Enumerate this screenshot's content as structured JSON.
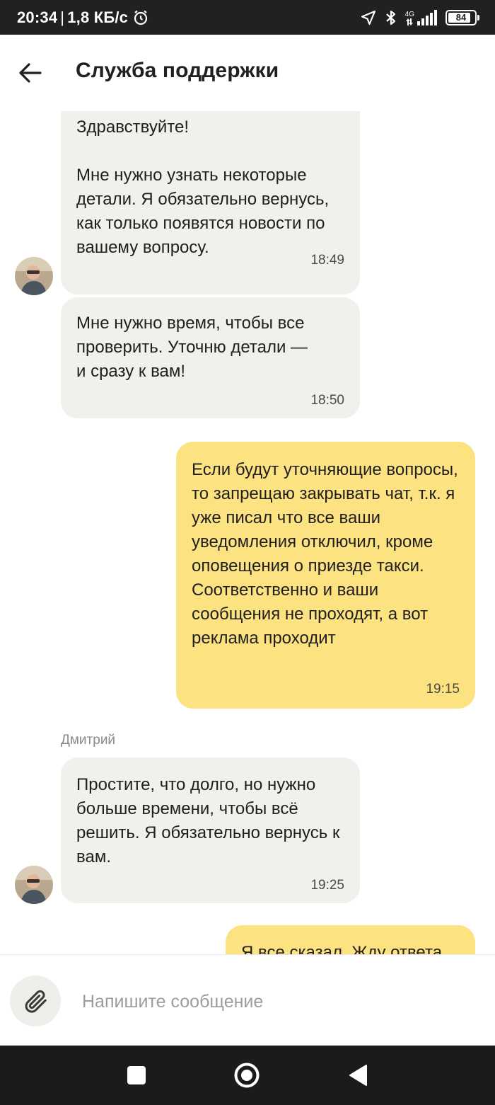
{
  "status_bar": {
    "time": "20:34",
    "separator": "|",
    "speed": "1,8 КБ/с",
    "network": "4G",
    "battery": "84",
    "icons": [
      "alarm-icon",
      "location-arrow-icon",
      "bluetooth-icon",
      "signal-icon",
      "battery-icon"
    ]
  },
  "header": {
    "title": "Служба поддержки",
    "back_icon": "arrow-left-icon"
  },
  "messages": [
    {
      "direction": "in",
      "text": "Здравствуйте!\n\nМне нужно узнать некоторые детали. Я обязательно вернусь, как только появятся новости по вашему вопросу.",
      "time": "18:49"
    },
    {
      "direction": "in",
      "text": "Мне нужно время, чтобы все проверить. Уточню детали —\nи сразу к вам!",
      "time": "18:50"
    },
    {
      "direction": "out",
      "text": "Если будут уточняющие вопросы, то запрещаю закрывать чат, т.к. я уже писал что все ваши уведомления отключил, кроме оповещения о приезде такси. Соответственно и ваши сообщения не проходят, а вот реклама проходит",
      "time": "19:15"
    },
    {
      "direction": "in",
      "sender": "Дмитрий",
      "text": "Простите, что долго, но нужно больше времени, чтобы всё решить. Я обязательно вернусь к вам.",
      "time": "19:25"
    },
    {
      "direction": "out",
      "text": "Я все сказал. Жду ответа",
      "time": ""
    }
  ],
  "composer": {
    "placeholder": "Напишите сообщение",
    "attach_icon": "paperclip-icon"
  },
  "nav": {
    "icons": [
      "square-recents-icon",
      "circle-home-icon",
      "triangle-back-icon"
    ]
  },
  "colors": {
    "incoming_bubble": "#f1f0ed",
    "outgoing_bubble": "#fce281",
    "status_bar": "#212121",
    "nav_bar": "#1b1b1b"
  }
}
